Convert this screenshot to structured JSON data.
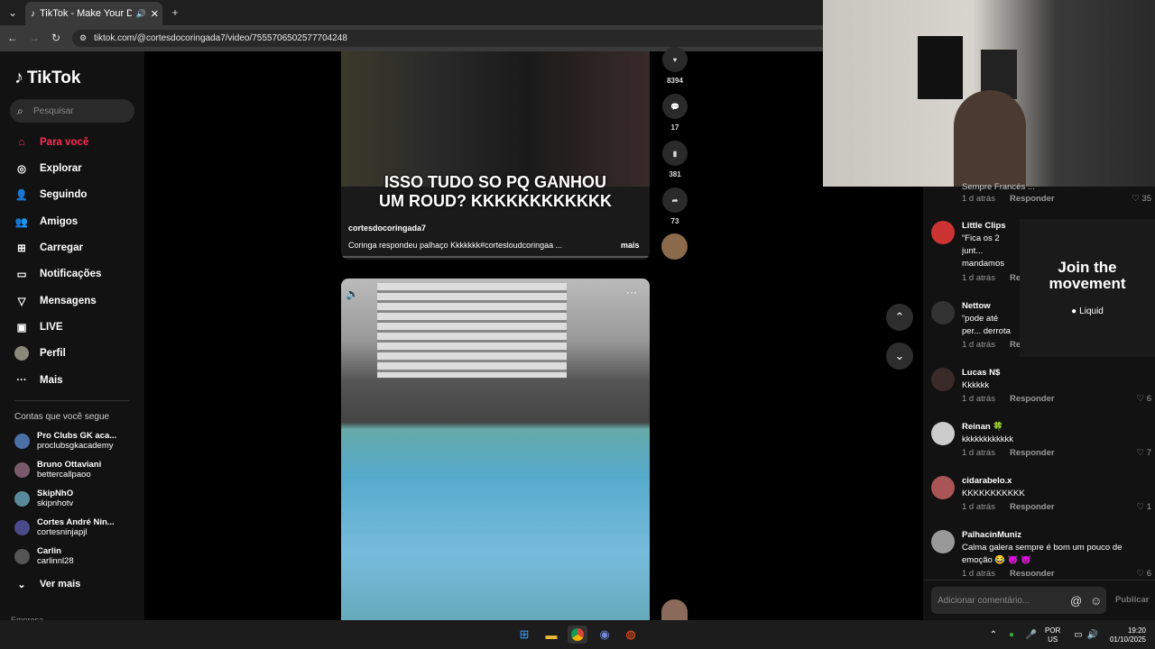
{
  "browser": {
    "tab_title": "TikTok - Make Your Day",
    "url": "tiktok.com/@cortesdocoringada7/video/7555706502577704248"
  },
  "sidebar": {
    "logo": "TikTok",
    "search_placeholder": "Pesquisar",
    "nav": [
      {
        "label": "Para você",
        "icon": "home-icon"
      },
      {
        "label": "Explorar",
        "icon": "compass-icon"
      },
      {
        "label": "Seguindo",
        "icon": "following-icon"
      },
      {
        "label": "Amigos",
        "icon": "friends-icon"
      },
      {
        "label": "Carregar",
        "icon": "upload-icon"
      },
      {
        "label": "Notificações",
        "icon": "notification-icon"
      },
      {
        "label": "Mensagens",
        "icon": "messages-icon"
      },
      {
        "label": "LIVE",
        "icon": "live-icon"
      },
      {
        "label": "Perfil",
        "icon": "profile-icon"
      },
      {
        "label": "Mais",
        "icon": "more-icon"
      }
    ],
    "following_heading": "Contas que você segue",
    "following": [
      {
        "name": "Pro Clubs GK aca...",
        "handle": "proclubsgkacademy"
      },
      {
        "name": "Bruno Ottaviani",
        "handle": "bettercallpaoo"
      },
      {
        "name": "SkipNhO",
        "handle": "skipnhotv"
      },
      {
        "name": "Cortes André Nin...",
        "handle": "cortesninjapjl"
      },
      {
        "name": "Carlin",
        "handle": "carlinnl28"
      }
    ],
    "see_more": "Ver mais",
    "footer_label": "Empresa"
  },
  "video1": {
    "overlay_text": "ISSO TUDO SO PQ GANHOU UM ROUD? KKKKKKKKKKKK",
    "author": "cortesdocoringada7",
    "caption": "Coringa respondeu palhaço Kkkkkkk#cortesloudcoringaa ...",
    "more": "mais"
  },
  "actions": {
    "likes": "8394",
    "comments": "17",
    "saves": "381",
    "shares": "73"
  },
  "ad": {
    "headline": "Join the movement",
    "brand": "Liquid"
  },
  "comments": {
    "top_partial_text": "Sempre Francés ...",
    "top_partial_meta": "1 d atrás",
    "reply_label": "Responder",
    "top_partial_likes": "35",
    "items": [
      {
        "user": "Little Clips",
        "text": "“Fica os 2 junt... mandamos vo... as farpas kkkk",
        "meta": "1 d atrás",
        "reply": "Re",
        "likes": ""
      },
      {
        "user": "Nettow",
        "text": "“pode até per... derrota 😂 😂",
        "meta": "1 d atrás",
        "reply": "Re",
        "likes": ""
      },
      {
        "user": "Lucas N$",
        "text": "Kkkkkk",
        "meta": "1 d atrás",
        "reply": "Responder",
        "likes": "6"
      },
      {
        "user": "Reinan 🍀",
        "text": "kkkkkkkkkkkk",
        "meta": "1 d atrás",
        "reply": "Responder",
        "likes": "7"
      },
      {
        "user": "cidarabelo.x",
        "text": "KKKKKKKKKKK",
        "meta": "1 d atrás",
        "reply": "Responder",
        "likes": "1"
      },
      {
        "user": "PalhacinMuniz",
        "text": "Calma galera sempre é bom um pouco de emoção 😂 😈 😈",
        "meta": "1 d atrás",
        "reply": "Responder",
        "likes": "6"
      }
    ],
    "input_placeholder": "Adicionar comentário...",
    "publish": "Publicar"
  },
  "taskbar": {
    "lang": "POR",
    "layout": "US",
    "time": "19:20",
    "date": "01/10/2025"
  },
  "colors": {
    "accent": "#fe2c55",
    "background": "#121212"
  }
}
